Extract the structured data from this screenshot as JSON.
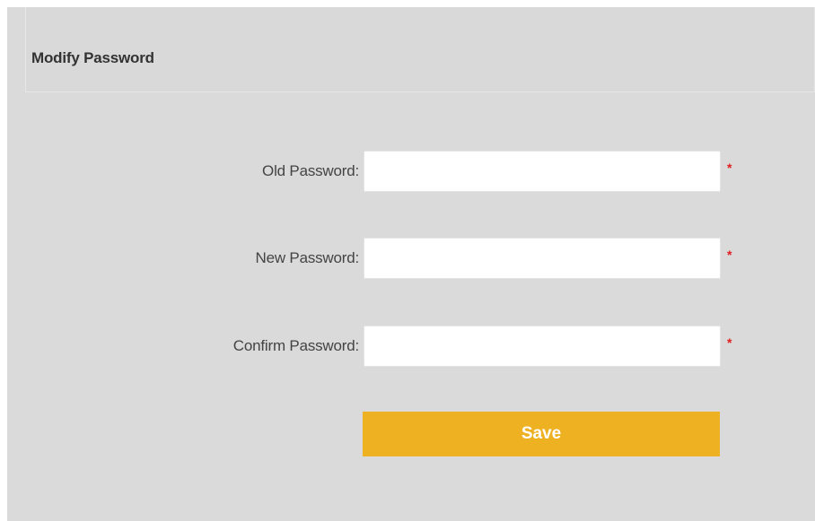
{
  "header": {
    "title": "Modify Password"
  },
  "form": {
    "fields": [
      {
        "label": "Old Password:",
        "value": "",
        "placeholder": "",
        "required_mark": "*"
      },
      {
        "label": "New Password:",
        "value": "",
        "placeholder": "",
        "required_mark": "*"
      },
      {
        "label": "Confirm Password:",
        "value": "",
        "placeholder": "",
        "required_mark": "*"
      }
    ],
    "save_label": "Save"
  },
  "colors": {
    "panel_background": "#dadada",
    "accent_button": "#eeb121",
    "required_mark": "#e02020"
  }
}
